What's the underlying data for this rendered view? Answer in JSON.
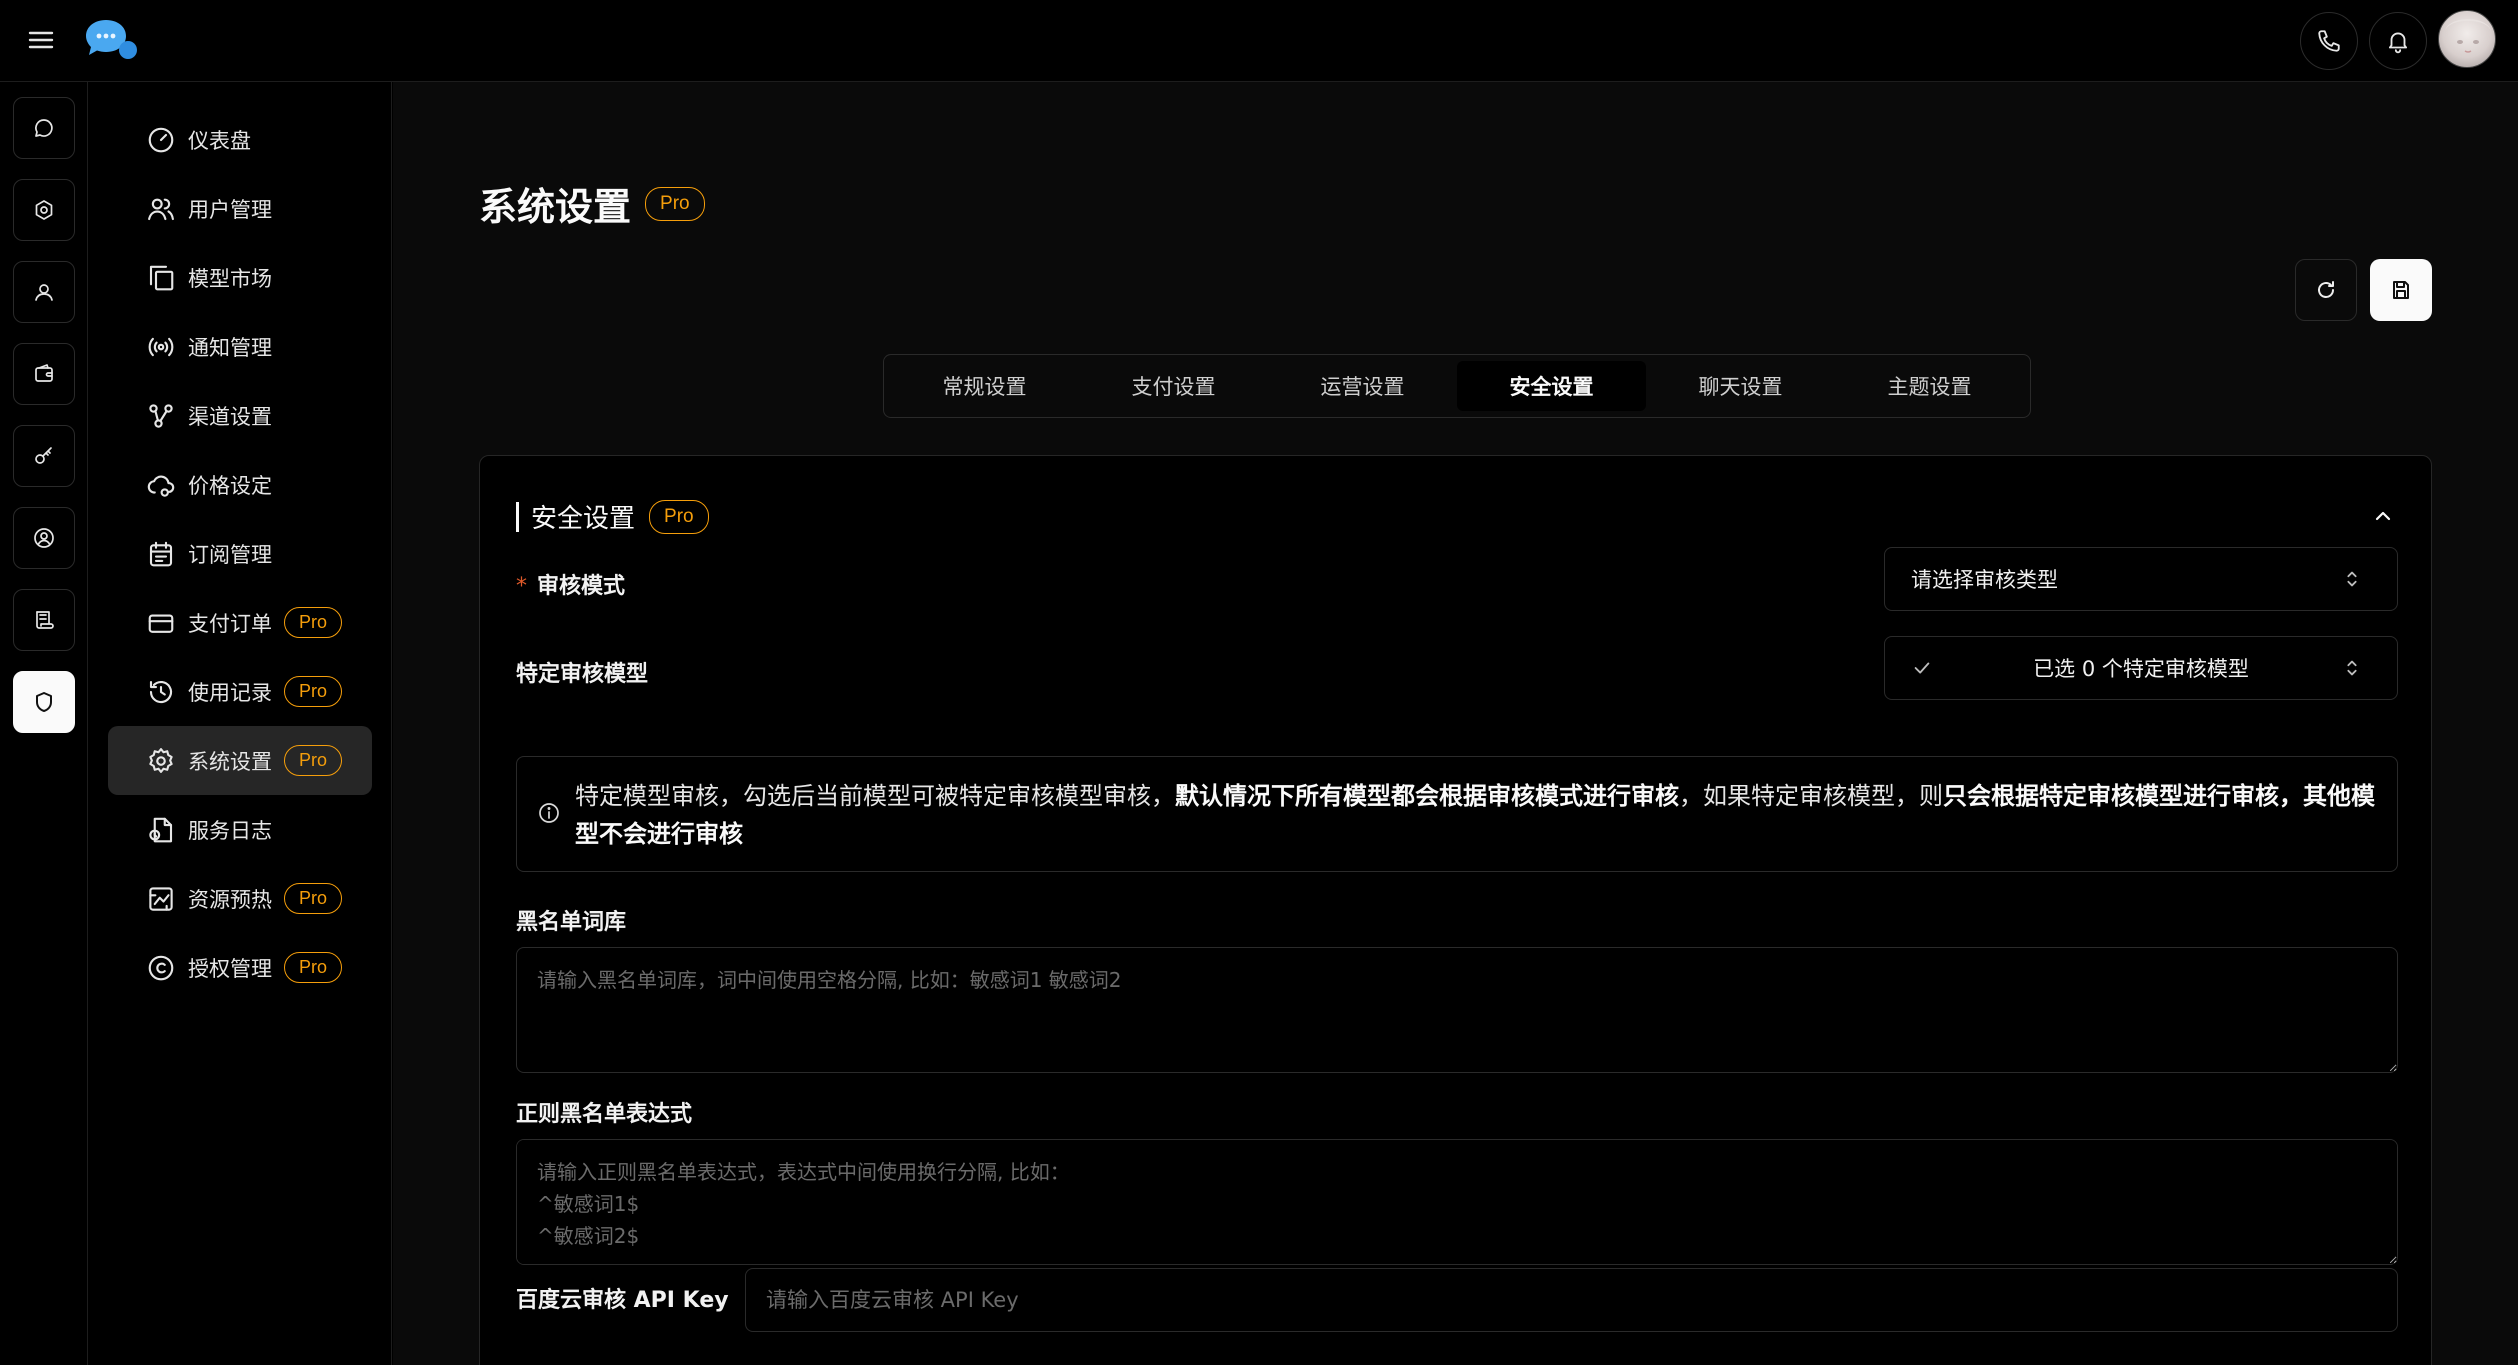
{
  "topbar": {
    "menu_icon": "menu-icon",
    "logo_icon": "chat-bubble-logo",
    "phone_icon": "phone-icon",
    "bell_icon": "bell-icon",
    "avatar": "user-avatar"
  },
  "rail": {
    "items": [
      {
        "icon": "chat-icon"
      },
      {
        "icon": "settings-icon"
      },
      {
        "icon": "user-icon"
      },
      {
        "icon": "wallet-icon"
      },
      {
        "icon": "key-icon"
      },
      {
        "icon": "account-icon"
      },
      {
        "icon": "receipt-icon"
      },
      {
        "icon": "shield-icon",
        "active": true
      }
    ]
  },
  "sidebar": {
    "items": [
      {
        "label": "仪表盘",
        "icon": "dashboard-gauge-icon"
      },
      {
        "label": "用户管理",
        "icon": "users-icon"
      },
      {
        "label": "模型市场",
        "icon": "copy-icon"
      },
      {
        "label": "通知管理",
        "icon": "broadcast-icon"
      },
      {
        "label": "渠道设置",
        "icon": "channel-icon"
      },
      {
        "label": "价格设定",
        "icon": "price-cloud-icon"
      },
      {
        "label": "订阅管理",
        "icon": "calendar-icon"
      },
      {
        "label": "支付订单",
        "icon": "credit-card-icon",
        "badge": "Pro"
      },
      {
        "label": "使用记录",
        "icon": "history-icon",
        "badge": "Pro"
      },
      {
        "label": "系统设置",
        "icon": "gear-icon",
        "badge": "Pro",
        "active": true
      },
      {
        "label": "服务日志",
        "icon": "log-file-icon"
      },
      {
        "label": "资源预热",
        "icon": "resource-icon",
        "badge": "Pro"
      },
      {
        "label": "授权管理",
        "icon": "copyright-icon",
        "badge": "Pro"
      }
    ]
  },
  "page": {
    "title": "系统设置",
    "badge": "Pro"
  },
  "toolbar": {
    "refresh_icon": "refresh-icon",
    "save_icon": "save-icon"
  },
  "tabs": [
    {
      "label": "常规设置"
    },
    {
      "label": "支付设置"
    },
    {
      "label": "运营设置"
    },
    {
      "label": "安全设置",
      "active": true
    },
    {
      "label": "聊天设置"
    },
    {
      "label": "主题设置"
    }
  ],
  "section": {
    "title": "安全设置",
    "badge": "Pro",
    "collapse_icon": "chevron-up-icon",
    "review_mode": {
      "required_mark": "*",
      "label": "审核模式",
      "value": "请选择审核类型"
    },
    "special_model": {
      "label": "特定审核模型",
      "value": "已选 0 个特定审核模型"
    },
    "notice": {
      "part1": "特定模型审核，勾选后当前模型可被特定审核模型审核，",
      "bold1": "默认情况下所有模型都会根据审核模式进行审核",
      "part2": "，如果特定审核模型，则",
      "bold2": "只会根据特定审核模型进行审核，其他模型不会进行审核"
    },
    "blacklist": {
      "label": "黑名单词库",
      "placeholder": "请输入黑名单词库，词中间使用空格分隔, 比如：敏感词1 敏感词2"
    },
    "regex_blacklist": {
      "label": "正则黑名单表达式",
      "placeholder": "请输入正则黑名单表达式，表达式中间使用换行分隔, 比如：\n^敏感词1$\n^敏感词2$"
    },
    "baidu_api_key": {
      "label": "百度云审核 API Key",
      "placeholder": "请输入百度云审核 API Key"
    }
  }
}
